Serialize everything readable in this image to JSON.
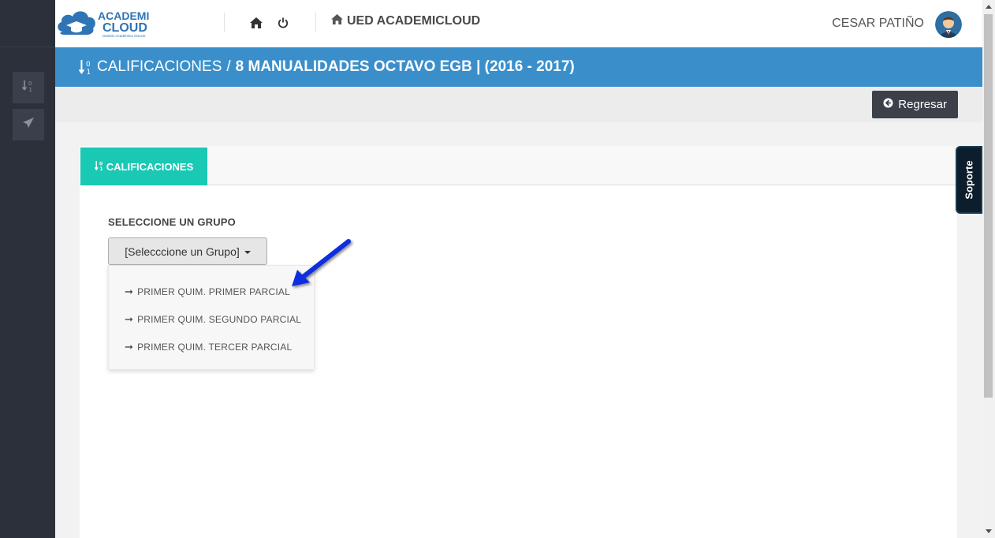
{
  "app": {
    "logo_top": "ACADEMI",
    "logo_bottom": "CLOUD",
    "logo_sub": "Gestión Académica OnLine",
    "org_name": "UED ACADEMICLOUD",
    "user_name": "CESAR PATIÑO"
  },
  "sidebar": {
    "items": [
      {
        "icon": "sort-numeric-icon"
      },
      {
        "icon": "paper-plane-icon"
      }
    ]
  },
  "header": {
    "icons": [
      "home-icon",
      "power-icon"
    ]
  },
  "titlebar": {
    "section": "CALIFICACIONES",
    "separator": "/",
    "course": "8 MANUALIDADES OCTAVO EGB | (2016 - 2017)"
  },
  "actions": {
    "back_label": "Regresar"
  },
  "tabs": [
    {
      "label": "CALIFICACIONES",
      "active": true
    }
  ],
  "form": {
    "group_label": "SELECCIONE UN GRUPO",
    "dropdown_value": "[Selecccione un Grupo]",
    "options": [
      "PRIMER QUIM. PRIMER PARCIAL",
      "PRIMER QUIM. SEGUNDO PARCIAL",
      "PRIMER QUIM. TERCER PARCIAL"
    ]
  },
  "support": {
    "label": "Soporte"
  },
  "colors": {
    "sidebar": "#2b303b",
    "titlebar": "#3a8fcb",
    "tab_active": "#1ac9b4",
    "button_dark": "#3b4049",
    "arrow": "#0a2ee0"
  }
}
